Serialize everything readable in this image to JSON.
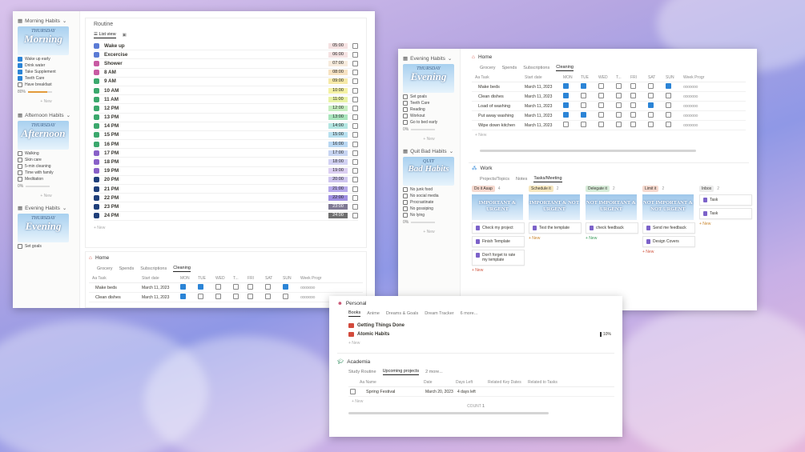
{
  "colors": {
    "accent": "#2b84d6",
    "progress": "#e39b3b",
    "bg": "#b7a7e2"
  },
  "left": {
    "morning": {
      "title": "Morning Habits",
      "day": "THURSDAY",
      "name": "Morning",
      "items": [
        {
          "t": "Wake up early",
          "c": true
        },
        {
          "t": "Drink water",
          "c": true
        },
        {
          "t": "Take Supplement",
          "c": true
        },
        {
          "t": "Teeth Care",
          "c": true
        },
        {
          "t": "Have breakfast",
          "c": false
        }
      ],
      "progress": "80%",
      "progress_value": 0.8,
      "new": "+ New"
    },
    "afternoon": {
      "title": "Afternoon Habits",
      "day": "THURSDAY",
      "name": "Afternoon",
      "items": [
        {
          "t": "Walking",
          "c": false
        },
        {
          "t": "Skin care",
          "c": false
        },
        {
          "t": "5-min cleaning",
          "c": false
        },
        {
          "t": "Time with family",
          "c": false
        },
        {
          "t": "Meditation",
          "c": false
        }
      ],
      "progress": "0%",
      "progress_value": 0,
      "new": "+ New"
    },
    "evening": {
      "title": "Evening Habits",
      "day": "THURSDAY",
      "name": "Evening",
      "items": [
        {
          "t": "Set goals",
          "c": false
        }
      ]
    },
    "routine": {
      "title": "Routine",
      "tab": "List view",
      "rows": [
        {
          "name": "Wake up",
          "time": "05:00",
          "color": "#5b7bd5",
          "tbg": "#f5e2e2"
        },
        {
          "name": "Excercise",
          "time": "06:00",
          "color": "#5b7bd5",
          "tbg": "#f5e2e2"
        },
        {
          "name": "Shower",
          "time": "07:00",
          "color": "#c85aa3",
          "tbg": "#f7ebdc"
        },
        {
          "name": "8 AM",
          "time": "08:00",
          "color": "#c85aa3",
          "tbg": "#f7e2c2"
        },
        {
          "name": "9 AM",
          "time": "09:00",
          "color": "#3ba86d",
          "tbg": "#f6e9a8"
        },
        {
          "name": "10 AM",
          "time": "10:00",
          "color": "#3ba86d",
          "tbg": "#f4f1a4"
        },
        {
          "name": "11 AM",
          "time": "11:00",
          "color": "#3ba86d",
          "tbg": "#e8f2a4"
        },
        {
          "name": "12 PM",
          "time": "12:00",
          "color": "#3ba86d",
          "tbg": "#c6eec0"
        },
        {
          "name": "13 PM",
          "time": "13:00",
          "color": "#3ba86d",
          "tbg": "#a9e5bd"
        },
        {
          "name": "14 PM",
          "time": "14:00",
          "color": "#3ba86d",
          "tbg": "#b4e6e2"
        },
        {
          "name": "15 PM",
          "time": "15:00",
          "color": "#3ba86d",
          "tbg": "#b8e0ef"
        },
        {
          "name": "16 PM",
          "time": "16:00",
          "color": "#3ba86d",
          "tbg": "#b9d7f2"
        },
        {
          "name": "17 PM",
          "time": "17:00",
          "color": "#8860c8",
          "tbg": "#c8d5f2"
        },
        {
          "name": "18 PM",
          "time": "18:00",
          "color": "#8860c8",
          "tbg": "#d3d2f3"
        },
        {
          "name": "19 PM",
          "time": "19:00",
          "color": "#8860c8",
          "tbg": "#dccff2"
        },
        {
          "name": "20 PM",
          "time": "20:00",
          "color": "#1f3f7a",
          "tbg": "#cfc6ef"
        },
        {
          "name": "21 PM",
          "time": "21:00",
          "color": "#1f3f7a",
          "tbg": "#b6a9ea"
        },
        {
          "name": "22 PM",
          "time": "22:00",
          "color": "#1f3f7a",
          "tbg": "#9f8fe1"
        },
        {
          "name": "23 PM",
          "time": "23:00",
          "color": "#1f3f7a",
          "tbg": "#7f7993"
        },
        {
          "name": "24 PM",
          "time": "24:00",
          "color": "#1f3f7a",
          "tbg": "#6e6e6e"
        }
      ],
      "new": "+ New"
    },
    "home": {
      "title": "Home",
      "tabs": [
        "Grocery",
        "Spends",
        "Subscriptions",
        "Cleaning"
      ],
      "headers": [
        "Aa Task",
        "Start date",
        "MON",
        "TUE",
        "WED",
        "T...",
        "FRI",
        "SAT",
        "SUN",
        "Week Progr"
      ],
      "rows": [
        {
          "task": "Make beds",
          "date": "March 11, 2023",
          "c": [
            true,
            true,
            false,
            false,
            false,
            false,
            true
          ]
        },
        {
          "task": "Clean dishes",
          "date": "March 11, 2023",
          "c": [
            true,
            false,
            false,
            false,
            false,
            false,
            false
          ]
        }
      ]
    }
  },
  "right": {
    "evening": {
      "title": "Evening Habits",
      "day": "THURSDAY",
      "name": "Evening",
      "items": [
        {
          "t": "Set goals"
        },
        {
          "t": "Teeth Care"
        },
        {
          "t": "Reading"
        },
        {
          "t": "Workout"
        },
        {
          "t": "Go to bed early"
        }
      ],
      "progress": "0%",
      "progress_value": 0,
      "new": "+ New"
    },
    "quit": {
      "title": "Quit Bad Habits",
      "day": "QUIT",
      "name": "Bad Habits",
      "items": [
        {
          "t": "No junk food"
        },
        {
          "t": "No social media"
        },
        {
          "t": "Procrastinate"
        },
        {
          "t": "No gossiping"
        },
        {
          "t": "No lying"
        }
      ],
      "progress": "0%",
      "progress_value": 0,
      "new": "+ New"
    },
    "home": {
      "title": "Home",
      "tabs": [
        "Grocery",
        "Spends",
        "Subscriptions",
        "Cleaning"
      ],
      "headers": [
        "Aa Task",
        "Start date",
        "MON",
        "TUE",
        "WED",
        "T...",
        "FRI",
        "SAT",
        "SUN",
        "Week Progr"
      ],
      "rows": [
        {
          "task": "Make beds",
          "date": "March 11, 2023",
          "c": [
            true,
            true,
            false,
            false,
            false,
            false,
            true
          ]
        },
        {
          "task": "Clean dishes",
          "date": "March 11, 2023",
          "c": [
            true,
            false,
            false,
            false,
            false,
            false,
            false
          ]
        },
        {
          "task": "Load of washing",
          "date": "March 11, 2023",
          "c": [
            true,
            false,
            false,
            false,
            false,
            true,
            false
          ]
        },
        {
          "task": "Put away washing",
          "date": "March 11, 2023",
          "c": [
            true,
            true,
            false,
            false,
            false,
            false,
            false
          ]
        },
        {
          "task": "Wipe down kitchen",
          "date": "March 11, 2023",
          "c": [
            false,
            false,
            false,
            false,
            false,
            false,
            false
          ]
        }
      ],
      "new": "+ New"
    },
    "work": {
      "title": "Work",
      "tabs": [
        "Projects/Topics",
        "Notes",
        "Tasks/Meeting"
      ],
      "columns": [
        {
          "head": "Do it Asap",
          "count": "4",
          "bg": "#f6d9cf",
          "img": "IMPORTANT & URGENT",
          "cards": [
            "Check my project",
            "Finish Template",
            "Don't forget to rate my template"
          ],
          "new": "+ New"
        },
        {
          "head": "Schedule it",
          "count": "2",
          "bg": "#f6e7bf",
          "img": "IMPORTANT & NOT URGENT",
          "cards": [
            "Test the template"
          ],
          "new": "+ New"
        },
        {
          "head": "Delegate it",
          "count": "2",
          "bg": "#d7ecd9",
          "img": "NOT IMPORTANT & URGENT",
          "cards": [
            "check feedback"
          ],
          "new": "+ New"
        },
        {
          "head": "Limit it",
          "count": "2",
          "bg": "#f6d9cf",
          "img": "NOT IMPORTANT & NOT URGENT",
          "cards": [
            "Send me feedback",
            "Design Covers"
          ],
          "new": "+ New"
        },
        {
          "head": "Inbox",
          "count": "2",
          "bg": "#ececec",
          "img": "",
          "cards": [
            "Task",
            "Task"
          ],
          "new": "+ New"
        }
      ]
    }
  },
  "bottom": {
    "personal": {
      "title": "Personal",
      "tabs": [
        "Books",
        "Anime",
        "Dreams & Goals",
        "Dream Tracker",
        "6 more..."
      ],
      "books": [
        {
          "name": "Getting Things Done",
          "pct": ""
        },
        {
          "name": "Atomic Habits",
          "pct": "10%"
        }
      ],
      "new": "+ New"
    },
    "academia": {
      "title": "Academia",
      "tabs": [
        "Study Routine",
        "Upcoming projects",
        "2 more..."
      ],
      "headers": [
        "Aa Name",
        "Date",
        "Days Left",
        "Related Key Dates",
        "Related to Tasks"
      ],
      "rows": [
        {
          "name": "Spring Festival",
          "date": "March 20, 2023",
          "left": "4 days left"
        }
      ],
      "new": "+ New",
      "count_label": "COUNT",
      "count": "1"
    }
  }
}
